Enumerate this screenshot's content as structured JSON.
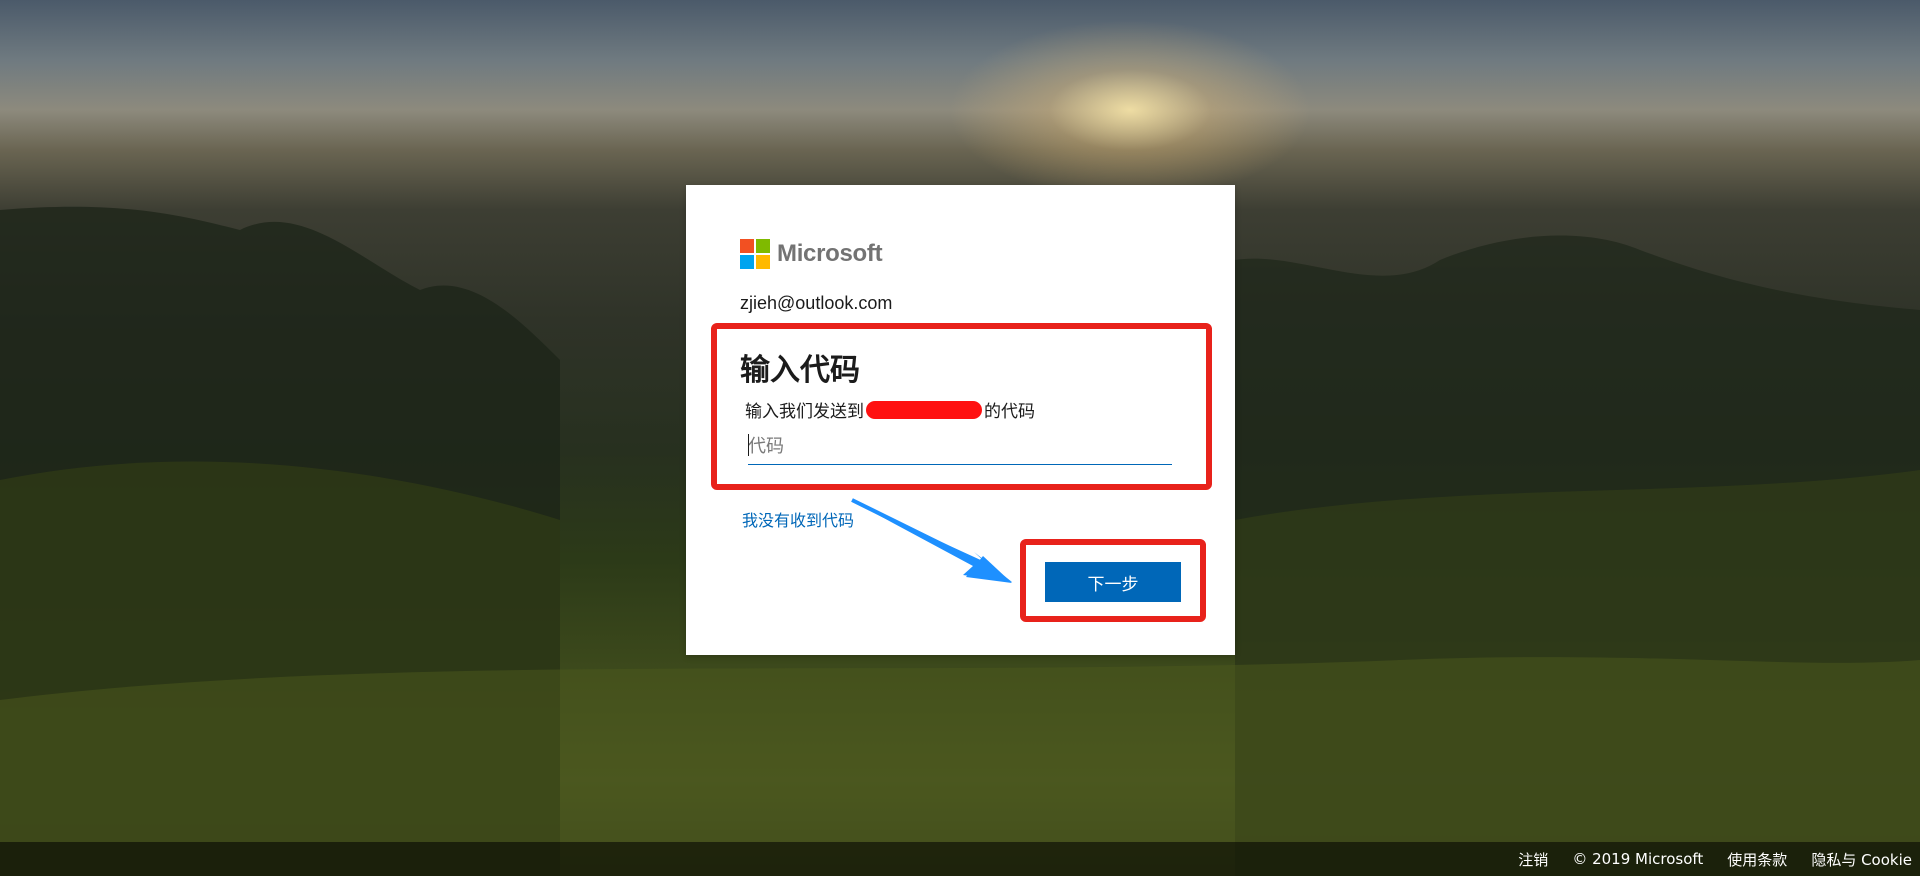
{
  "brand": {
    "name": "Microsoft",
    "colors": {
      "red": "#f25022",
      "green": "#7fba00",
      "blue": "#00a4ef",
      "yellow": "#ffb900"
    }
  },
  "signin": {
    "identity": "zjieh@outlook.com",
    "title": "输入代码",
    "description_prefix": "输入我们发送到",
    "description_suffix": "的代码",
    "code_placeholder": "代码",
    "code_value": "",
    "no_code_link": "我没有收到代码",
    "next_button": "下一步"
  },
  "footer": {
    "sign_out": "注销",
    "copyright": "© 2019 Microsoft",
    "terms": "使用条款",
    "privacy": "隐私与 Cookie"
  },
  "theme": {
    "accent": "#0067b8",
    "annotation": "#e8221b",
    "arrow": "#1e90ff"
  }
}
